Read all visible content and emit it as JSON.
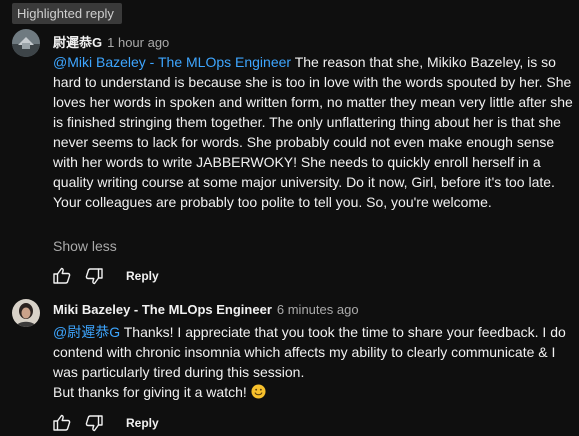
{
  "badge": {
    "label": "Highlighted reply"
  },
  "comment1": {
    "author": "尉遲恭G",
    "time": "1 hour ago",
    "mention": "@Miki Bazeley - The MLOps Engineer",
    "text": " The reason that she,  Mikiko Bazeley, is so hard to understand is because she is too in love with the words spouted by her.  She loves her words in spoken and written form, no matter they mean very little after she is finished stringing them together. The only unflattering thing about her is that she never seems to lack for words.  She probably could not even make enough sense with her words to write JABBERWOKY!  She needs to quickly enroll herself in a quality writing course at some major university.  Do it now, Girl, before it's too late.  Your colleagues are probably too polite to tell you.  So, you're welcome.",
    "show_less": "Show less",
    "reply": "Reply"
  },
  "comment2": {
    "author": "Miki Bazeley - The MLOps Engineer",
    "time": "6 minutes ago",
    "mention": "@尉遲恭G",
    "text": "  Thanks! I appreciate that you took the time to share your feedback. I do contend with chronic insomnia which affects my ability to clearly communicate & I was particularly tired during this session.",
    "text2": "But thanks for giving it a watch! ",
    "reply": "Reply"
  },
  "colors": {
    "background": "#0f0f0f",
    "mention": "#3ea6ff",
    "secondary_text": "#aaaaaa"
  }
}
